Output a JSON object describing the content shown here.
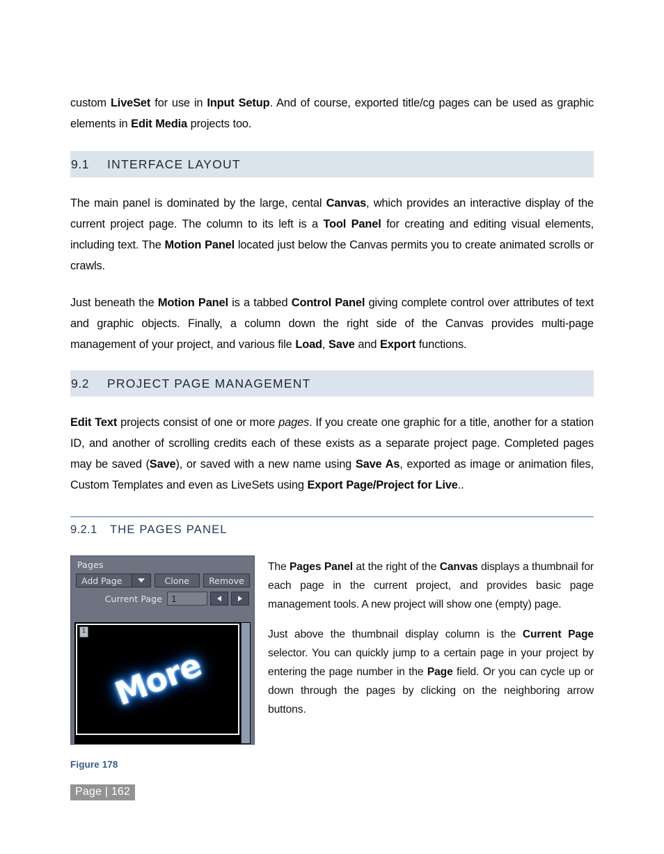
{
  "document": {
    "intro_paragraph": {
      "runs": [
        {
          "t": "custom ",
          "b": false
        },
        {
          "t": "LiveSet",
          "b": true
        },
        {
          "t": " for use in ",
          "b": false
        },
        {
          "t": "Input Setup",
          "b": true
        },
        {
          "t": ".  And of course, exported title/cg pages can be used as graphic elements in ",
          "b": false
        },
        {
          "t": "Edit Media",
          "b": true
        },
        {
          "t": " projects too.",
          "b": false
        }
      ]
    },
    "section_9_1": {
      "number": "9.1",
      "title": "INTERFACE LAYOUT",
      "paragraph": {
        "runs": [
          {
            "t": "The main panel is dominated by the large, cental ",
            "b": false
          },
          {
            "t": "Canvas",
            "b": true
          },
          {
            "t": ", which provides an interactive display of the current project page.  The column to its left is a ",
            "b": false
          },
          {
            "t": "Tool Panel",
            "b": true
          },
          {
            "t": " for creating and editing visual elements, including text.  The ",
            "b": false
          },
          {
            "t": "Motion Panel",
            "b": true
          },
          {
            "t": " located just below the Canvas permits you to create animated scrolls or crawls.",
            "b": false
          }
        ]
      },
      "paragraph2": {
        "runs": [
          {
            "t": "Just beneath the ",
            "b": false
          },
          {
            "t": "Motion Panel",
            "b": true
          },
          {
            "t": " is a tabbed ",
            "b": false
          },
          {
            "t": "Control Panel",
            "b": true
          },
          {
            "t": " giving complete control over attributes of text and graphic objects. Finally, a column down the right side of the Canvas provides multi-page management of your project,  and various file ",
            "b": false
          },
          {
            "t": "Load",
            "b": true
          },
          {
            "t": ", ",
            "b": false
          },
          {
            "t": "Save",
            "b": true
          },
          {
            "t": " and ",
            "b": false
          },
          {
            "t": "Export",
            "b": true
          },
          {
            "t": " functions.",
            "b": false
          }
        ]
      }
    },
    "section_9_2": {
      "number": "9.2",
      "title": "PROJECT PAGE MANAGEMENT",
      "paragraph": {
        "runs": [
          {
            "t": "Edit Text",
            "b": true
          },
          {
            "t": " projects consist of one or more ",
            "b": false
          },
          {
            "t": "pages",
            "b": false,
            "i": true
          },
          {
            "t": ". If you create one graphic for a title, another for a station ID, and another of scrolling credits each of these exists as a separate project page. Completed pages may be saved (",
            "b": false
          },
          {
            "t": "Save",
            "b": true
          },
          {
            "t": "), or saved with a new name using ",
            "b": false
          },
          {
            "t": "Save As",
            "b": true
          },
          {
            "t": ", exported as image or animation files, Custom Templates and even as LiveSets using ",
            "b": false
          },
          {
            "t": "Export Page/Project for Live",
            "b": true
          },
          {
            "t": "..",
            "b": false
          }
        ]
      }
    },
    "section_9_2_1": {
      "number": "9.2.1",
      "title": "THE PAGES PANEL",
      "paragraph1": {
        "runs": [
          {
            "t": "The ",
            "b": false
          },
          {
            "t": "Pages Panel",
            "b": true
          },
          {
            "t": " at the right of the ",
            "b": false
          },
          {
            "t": "Canvas",
            "b": true
          },
          {
            "t": " displays a thumbnail for each page in the current project, and provides basic page management tools.  A new project will show one (empty) page.",
            "b": false
          }
        ]
      },
      "paragraph2": {
        "runs": [
          {
            "t": "Just above the thumbnail display column is the ",
            "b": false
          },
          {
            "t": "Current Page",
            "b": true
          },
          {
            "t": " selector. You can quickly jump to a certain page in your project by entering the page number in the ",
            "b": false
          },
          {
            "t": "Page",
            "b": true
          },
          {
            "t": " field. Or you can cycle up or down through the pages by clicking on the neighboring arrow buttons.",
            "b": false
          }
        ]
      }
    },
    "figure": {
      "caption": "Figure 178",
      "panel": {
        "title": "Pages",
        "add_page_label": "Add Page",
        "dropdown_icon": "chevron-down-icon",
        "clone_label": "Clone",
        "remove_label": "Remove",
        "current_page_label": "Current Page",
        "current_page_value": "1",
        "prev_icon": "triangle-left-icon",
        "next_icon": "triangle-right-icon",
        "thumbnail": {
          "badge": "1",
          "text": "More"
        }
      }
    },
    "footer": {
      "page_label": "Page | 162"
    }
  },
  "colors": {
    "section_bar_bg": "#dbe3ec",
    "subsection_text": "#21365e",
    "subsection_rule": "#4a6f96",
    "figure_caption": "#365a91",
    "footer_badge_bg": "#939393",
    "panel_bg": "#6d7380",
    "panel_glow": "#4fa8ff"
  }
}
